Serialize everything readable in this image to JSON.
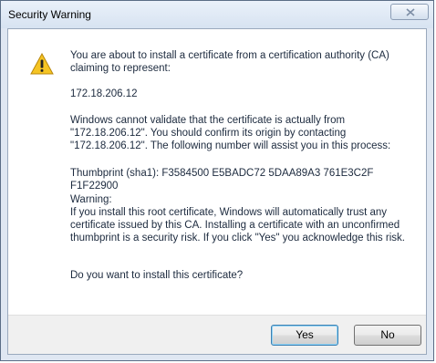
{
  "window": {
    "title": "Security Warning"
  },
  "icons": {
    "warning": "warning-icon",
    "close": "close-icon"
  },
  "message": {
    "intro": "You are about to install a certificate from a certification authority (CA) claiming to represent:",
    "host": "172.18.206.12",
    "validation": "Windows cannot validate that the certificate is actually from \"172.18.206.12\". You should confirm its origin by contacting \"172.18.206.12\". The following number will assist you in this process:",
    "thumbprint": "Thumbprint (sha1): F3584500 E5BADC72 5DAA89A3 761E3C2F F1F22900",
    "warning_heading": "Warning:",
    "warning_body": "If you install this root certificate, Windows will automatically trust any certificate issued by this CA. Installing a certificate with an unconfirmed thumbprint is a security risk. If you click \"Yes\" you acknowledge this risk.",
    "question": "Do you want to install this certificate?"
  },
  "buttons": {
    "yes": "Yes",
    "no": "No"
  }
}
